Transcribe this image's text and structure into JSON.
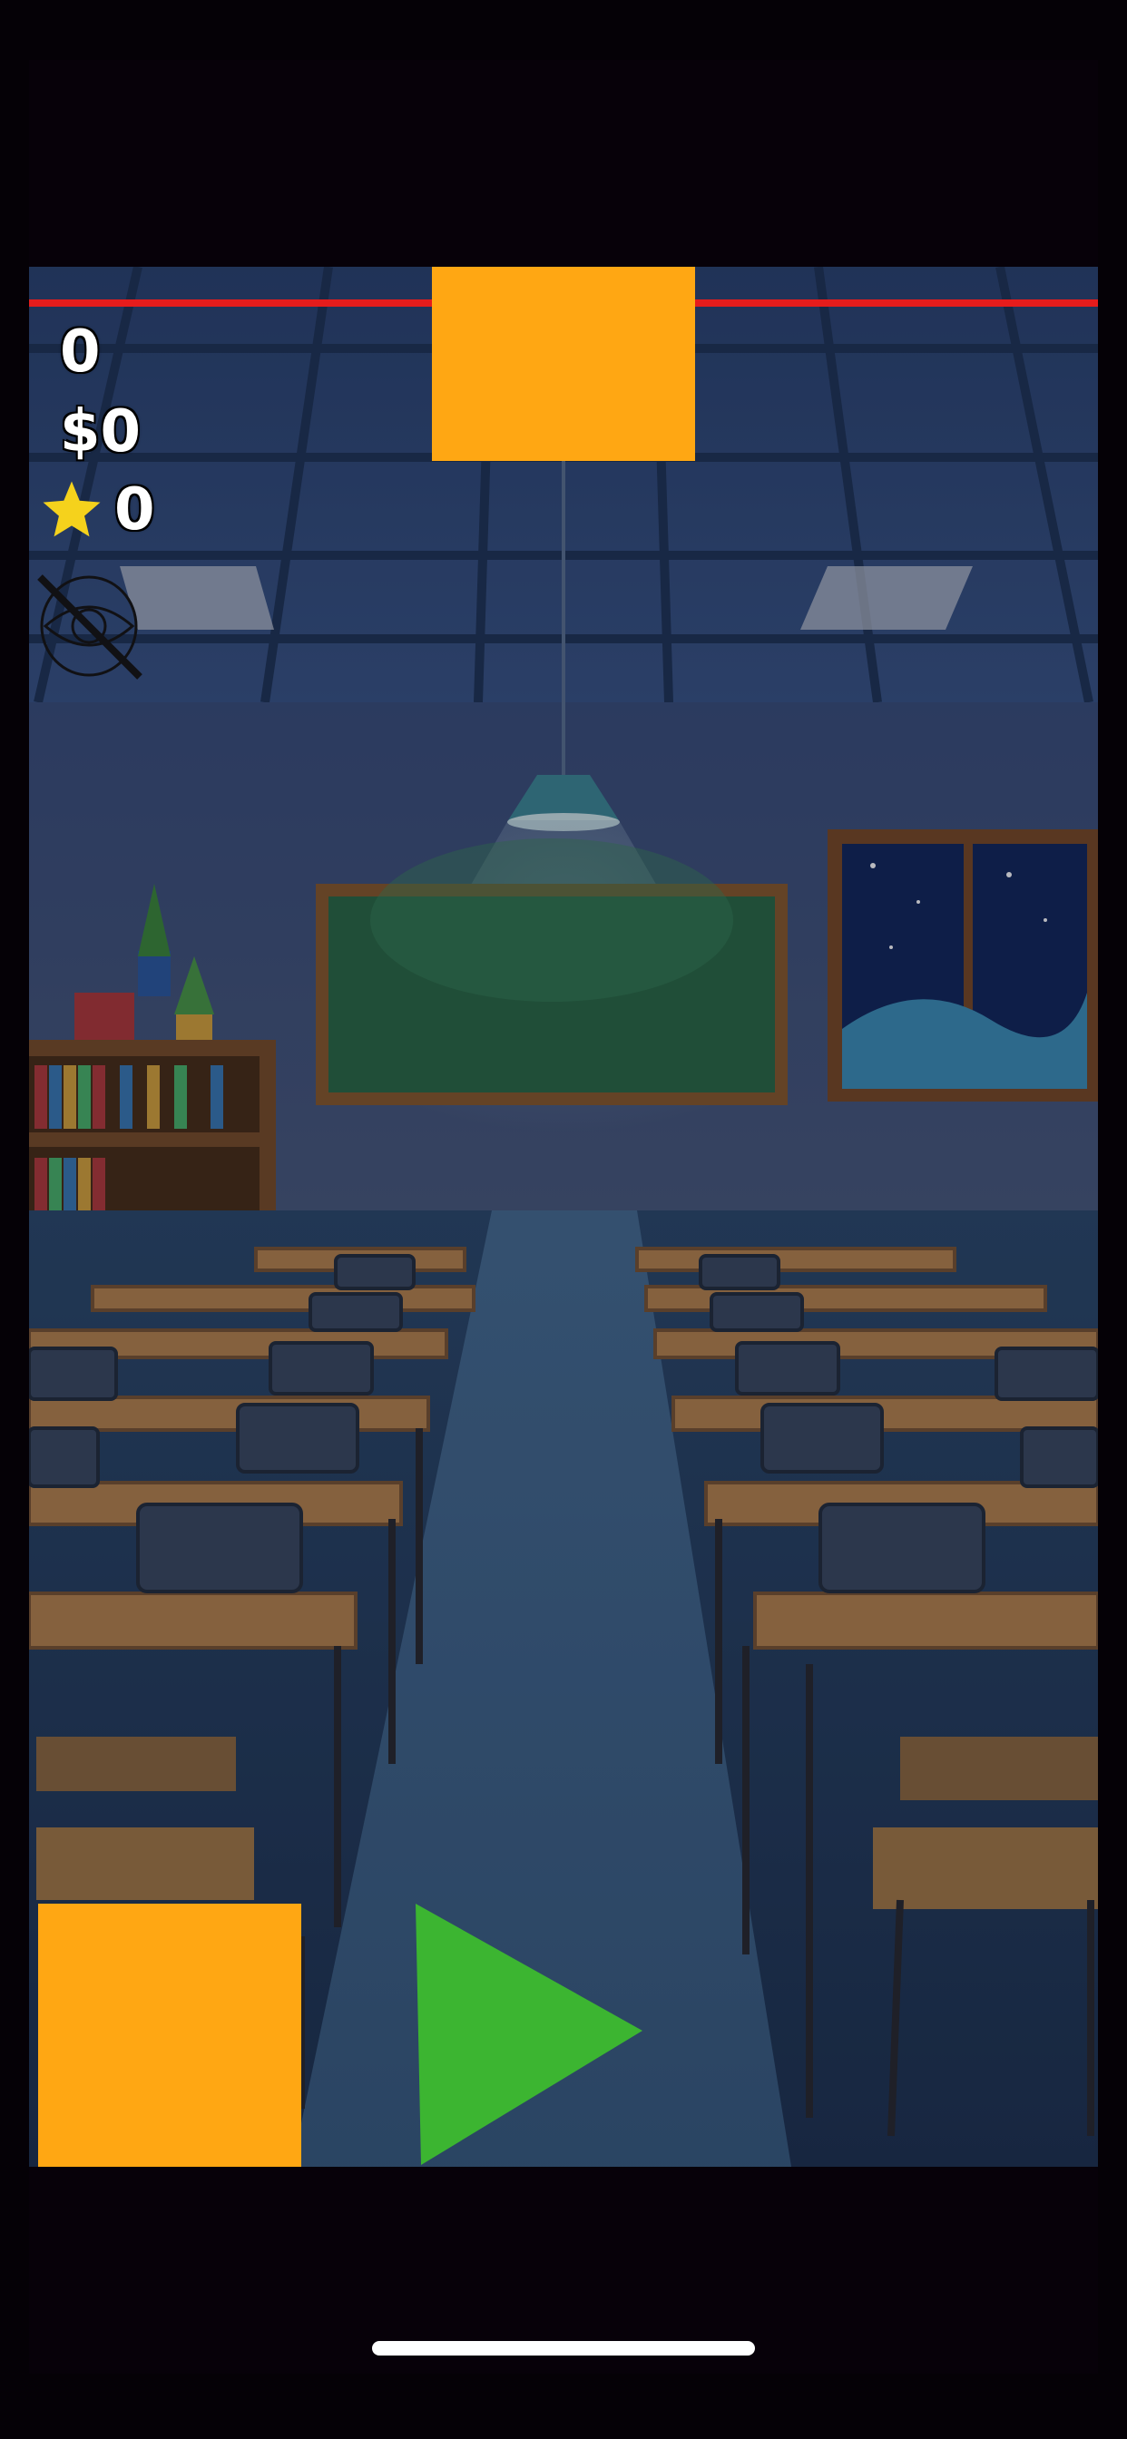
{
  "hud": {
    "score": "0",
    "money": "$0",
    "stars": "0"
  },
  "icons": {
    "star": "star-icon",
    "hide_toggle": "eye-slash-icon",
    "play": "play-icon"
  },
  "colors": {
    "block": "#ffa713",
    "play": "#3cb531",
    "limit_line": "#e51c1c",
    "star": "#f5d21c"
  }
}
